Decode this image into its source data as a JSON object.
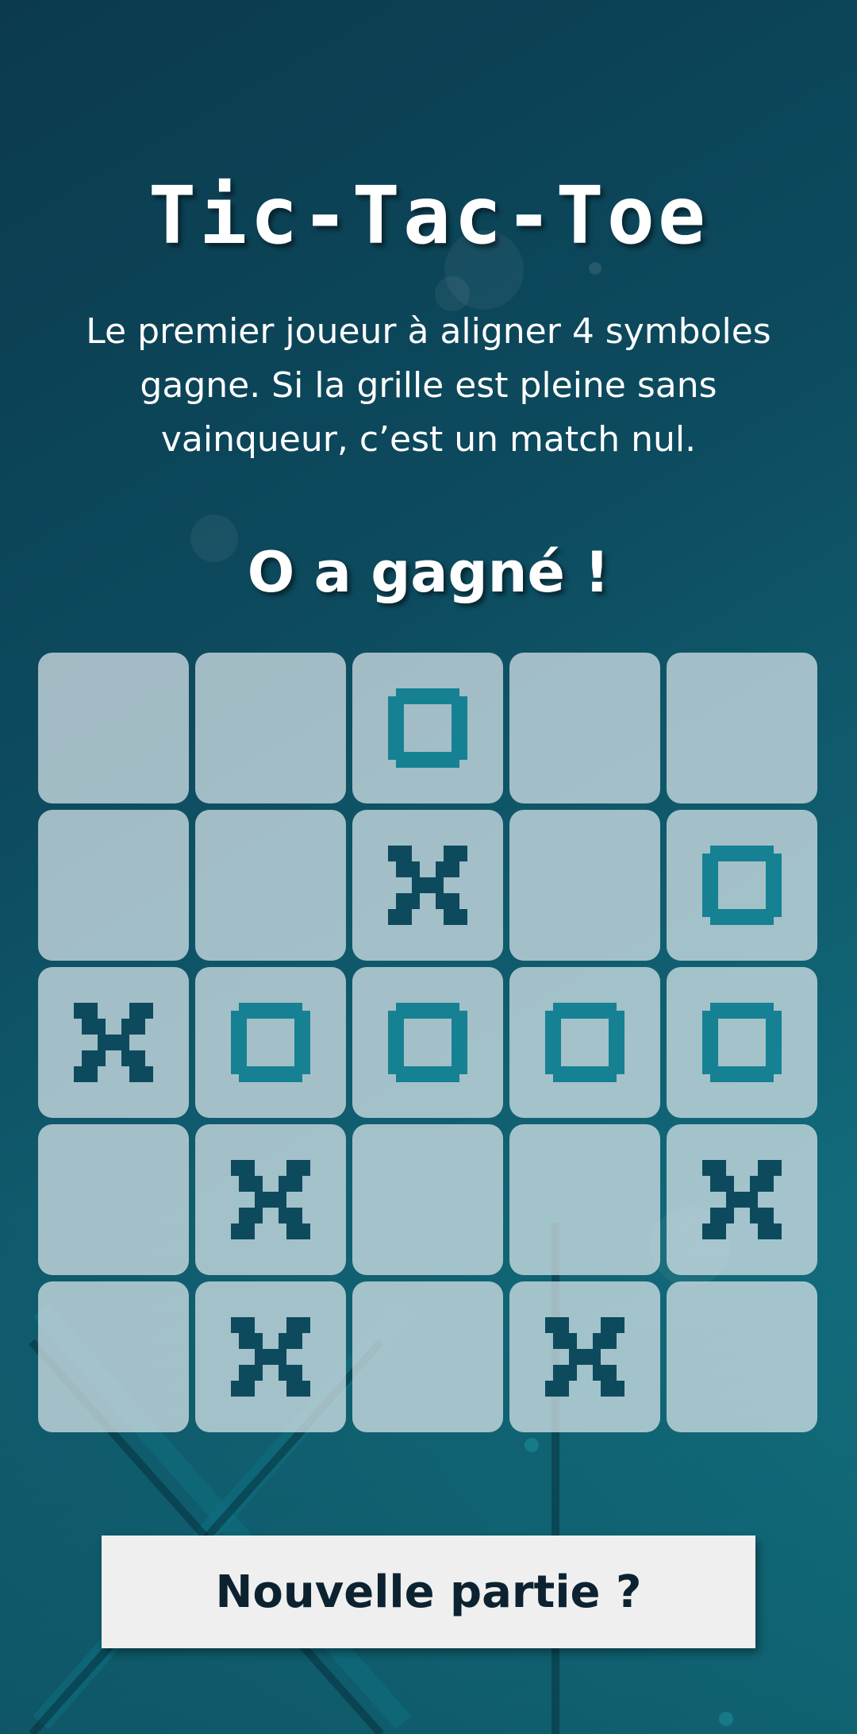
{
  "title": "Tic-Tac-Toe",
  "rules": "Le premier joueur à aligner 4 symboles gagne. Si la grille est pleine sans vainqueur, c’est un match nul.",
  "status": "O a gagné !",
  "new_game_label": "Nouvelle partie ?",
  "colors": {
    "x_mark": "#0e4a5e",
    "o_mark": "#168193",
    "cell": "#dce8ec",
    "button": "#efefef"
  },
  "board": [
    [
      "",
      "",
      "O",
      "",
      ""
    ],
    [
      "",
      "",
      "X",
      "",
      "O"
    ],
    [
      "X",
      "O",
      "O",
      "O",
      "O"
    ],
    [
      "",
      "X",
      "",
      "",
      "X"
    ],
    [
      "",
      "X",
      "",
      "X",
      ""
    ]
  ]
}
